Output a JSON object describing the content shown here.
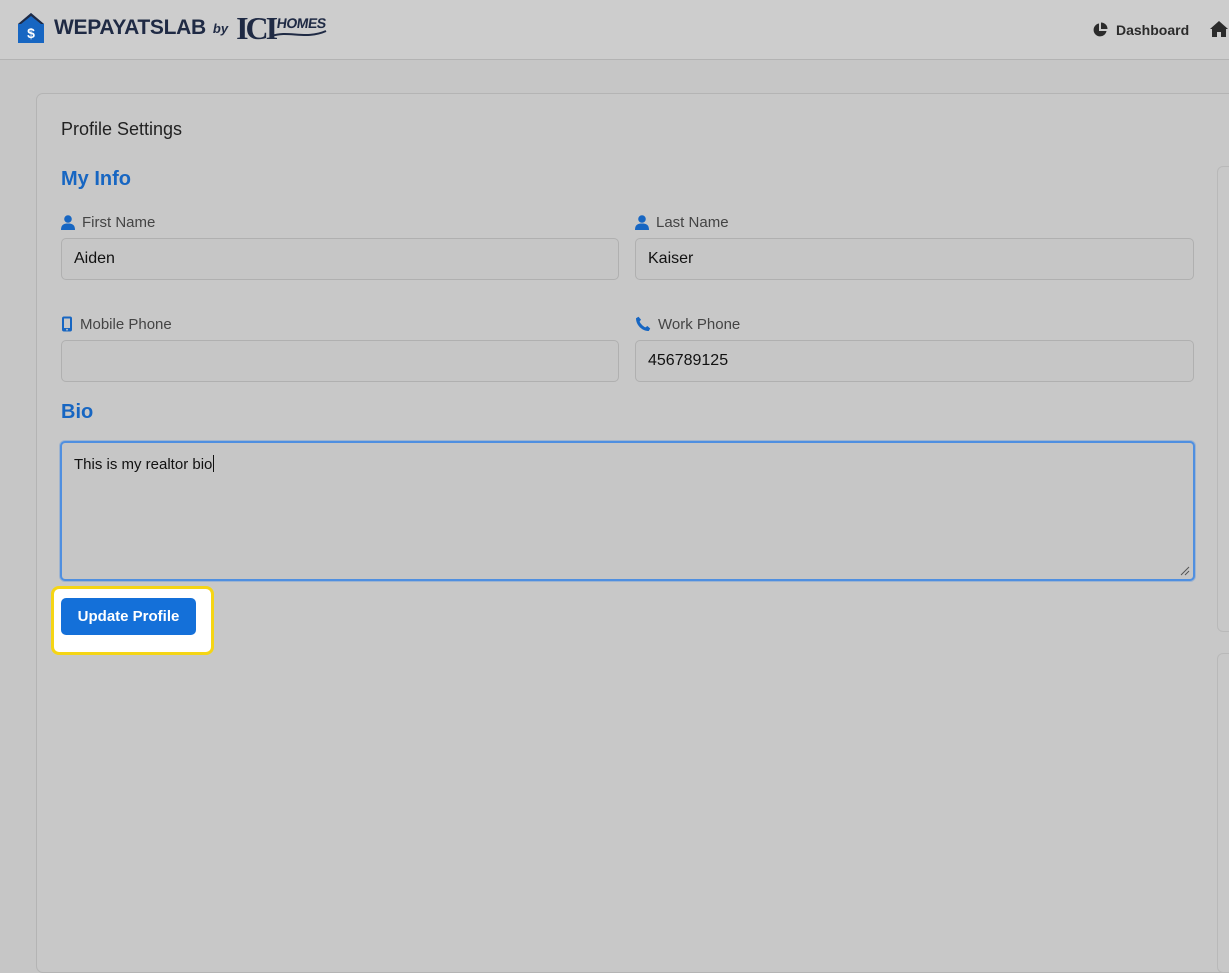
{
  "brand": {
    "name": "WEPAYATSLAB",
    "by": "by",
    "partner_mark": "ICI",
    "partner_word": "HOMES"
  },
  "nav": {
    "dashboard_label": "Dashboard"
  },
  "page": {
    "title": "Profile Settings"
  },
  "my_info": {
    "heading": "My Info",
    "first_name": {
      "label": "First Name",
      "value": "Aiden"
    },
    "last_name": {
      "label": "Last Name",
      "value": "Kaiser"
    },
    "mobile_phone": {
      "label": "Mobile Phone",
      "value": ""
    },
    "work_phone": {
      "label": "Work Phone",
      "value": "456789125"
    }
  },
  "bio": {
    "heading": "Bio",
    "value": "This is my realtor bio"
  },
  "actions": {
    "update_label": "Update Profile"
  },
  "colors": {
    "accent": "#1766c2",
    "button": "#1470d9",
    "highlight": "#f5d515"
  }
}
